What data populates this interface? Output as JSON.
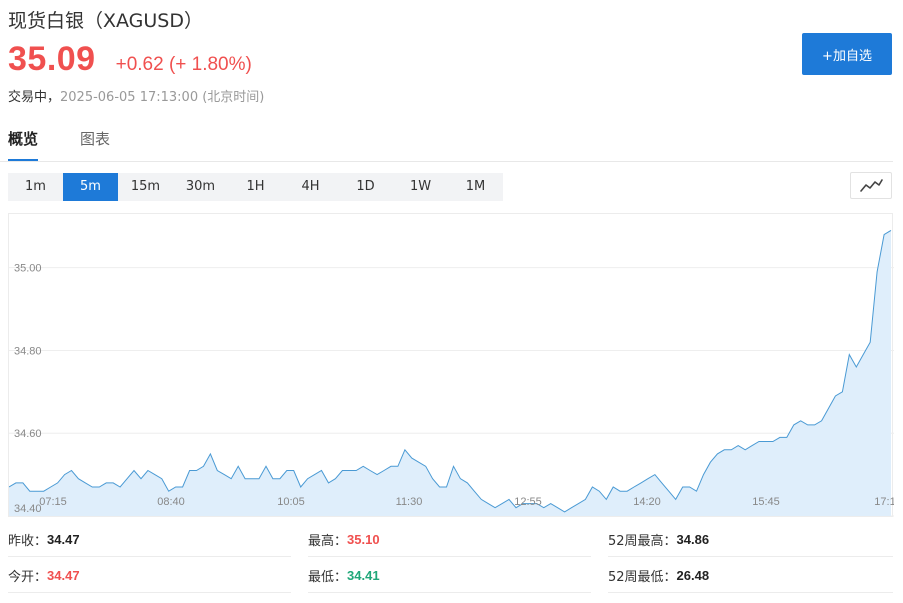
{
  "header": {
    "title": "现货白银（XAGUSD）",
    "price": "35.09",
    "change": "+0.62 (+ 1.80%)",
    "status": "交易中，",
    "timestamp": "2025-06-05 17:13:00 (北京时间)",
    "add_button": "+加自选"
  },
  "tabs": [
    {
      "label": "概览",
      "active": true
    },
    {
      "label": "图表",
      "active": false
    }
  ],
  "periods": [
    "1m",
    "5m",
    "15m",
    "30m",
    "1H",
    "4H",
    "1D",
    "1W",
    "1M"
  ],
  "selected_period": "5m",
  "chart_type_icon": "line-chart-icon",
  "colors": {
    "up": "#f0504f",
    "down": "#20a779",
    "accent": "#1e7ad8",
    "line": "#4a9ad4",
    "area": "#dfeefb"
  },
  "stats": [
    {
      "label": "昨收：",
      "value": "34.47",
      "tone": "neutral"
    },
    {
      "label": "最高：",
      "value": "35.10",
      "tone": "up"
    },
    {
      "label": "52周最高：",
      "value": "34.86",
      "tone": "neutral"
    },
    {
      "label": "今开：",
      "value": "34.47",
      "tone": "up"
    },
    {
      "label": "最低：",
      "value": "34.41",
      "tone": "down"
    },
    {
      "label": "52周最低：",
      "value": "26.48",
      "tone": "neutral"
    }
  ],
  "chart_data": {
    "type": "area",
    "ylim": [
      34.4,
      35.12
    ],
    "y_ticks": [
      "34.40",
      "34.60",
      "34.80",
      "35.00"
    ],
    "x_ticks": [
      "07:15",
      "08:40",
      "10:05",
      "11:30",
      "12:55",
      "14:20",
      "15:45",
      "17:1"
    ],
    "grid": true,
    "legend": "none",
    "values": [
      34.47,
      34.48,
      34.48,
      34.46,
      34.46,
      34.46,
      34.47,
      34.48,
      34.5,
      34.51,
      34.49,
      34.48,
      34.47,
      34.47,
      34.48,
      34.48,
      34.47,
      34.49,
      34.51,
      34.49,
      34.51,
      34.5,
      34.49,
      34.46,
      34.47,
      34.47,
      34.51,
      34.51,
      34.52,
      34.55,
      34.51,
      34.5,
      34.49,
      34.52,
      34.49,
      34.49,
      34.49,
      34.52,
      34.49,
      34.49,
      34.51,
      34.51,
      34.47,
      34.49,
      34.5,
      34.51,
      34.48,
      34.49,
      34.51,
      34.51,
      34.51,
      34.52,
      34.51,
      34.5,
      34.51,
      34.52,
      34.52,
      34.56,
      34.54,
      34.53,
      34.52,
      34.49,
      34.47,
      34.47,
      34.52,
      34.49,
      34.48,
      34.46,
      34.44,
      34.43,
      34.42,
      34.43,
      34.44,
      34.42,
      34.43,
      34.43,
      34.43,
      34.42,
      34.43,
      34.42,
      34.41,
      34.42,
      34.43,
      34.44,
      34.47,
      34.46,
      34.44,
      34.47,
      34.46,
      34.46,
      34.47,
      34.48,
      34.49,
      34.5,
      34.48,
      34.46,
      34.44,
      34.47,
      34.47,
      34.46,
      34.5,
      34.53,
      34.55,
      34.56,
      34.56,
      34.57,
      34.56,
      34.57,
      34.58,
      34.58,
      34.58,
      34.59,
      34.59,
      34.62,
      34.63,
      34.62,
      34.62,
      34.63,
      34.66,
      34.69,
      34.7,
      34.79,
      34.76,
      34.79,
      34.82,
      34.99,
      35.08,
      35.09
    ]
  }
}
